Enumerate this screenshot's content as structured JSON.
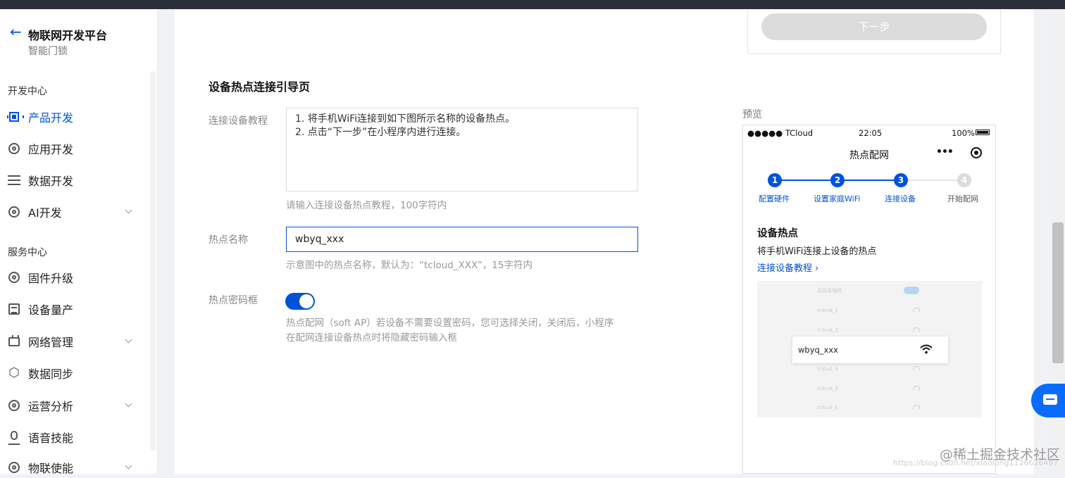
{
  "sidebar": {
    "back_icon": "arrow-left-icon",
    "app_title": "物联网开发平台",
    "app_subtitle": "智能门锁",
    "groups": [
      {
        "title": "开发中心"
      },
      {
        "title": "服务中心"
      }
    ],
    "items": [
      {
        "label": "产品开发",
        "icon": "chip-icon",
        "active": true
      },
      {
        "label": "应用开发",
        "icon": "app-ring-icon"
      },
      {
        "label": "数据开发",
        "icon": "data-flow-icon"
      },
      {
        "label": "AI开发",
        "icon": "ai-icon",
        "expandable": true
      },
      {
        "label": "固件升级",
        "icon": "firmware-icon"
      },
      {
        "label": "设备量产",
        "icon": "production-icon"
      },
      {
        "label": "网络管理",
        "icon": "network-icon",
        "expandable": true
      },
      {
        "label": "数据同步",
        "icon": "sync-icon"
      },
      {
        "label": "运营分析",
        "icon": "analytics-icon",
        "expandable": true
      },
      {
        "label": "语音技能",
        "icon": "voice-icon"
      },
      {
        "label": "物联使能",
        "icon": "iot-enable-icon",
        "expandable": true
      }
    ]
  },
  "top_card": {
    "next_button_label": "下一步"
  },
  "form": {
    "section_title": "设备热点连接引导页",
    "tutorial_label": "连接设备教程",
    "tutorial_value": "1. 将手机WiFi连接到如下图所示名称的设备热点。\n2. 点击“下一步”在小程序内进行连接。",
    "tutorial_hint": "请输入连接设备热点教程，100字符内",
    "hotspot_label": "热点名称",
    "hotspot_value": "wbyq_xxx",
    "hotspot_hint": "示意图中的热点名称，默认为：“tcloud_XXX”，15字符内",
    "password_label": "热点密码框",
    "password_toggle_on": true,
    "password_hint_1": "热点配网（soft AP）若设备不需要设置密码，您可选择关闭，关闭后，小程序",
    "password_hint_2": "在配网连接设备热点时将隐藏密码输入框"
  },
  "preview": {
    "label": "预览",
    "status_carrier": "●●●●● TCloud",
    "status_time": "22:05",
    "status_battery": "100%",
    "title": "热点配网",
    "menu_dots": "•••",
    "steps": [
      {
        "num": "1",
        "label": "配置硬件",
        "done": true
      },
      {
        "num": "2",
        "label": "设置家庭WiFi",
        "done": true
      },
      {
        "num": "3",
        "label": "连接设备",
        "done": true
      },
      {
        "num": "4",
        "label": "开始配网",
        "done": false
      }
    ],
    "heading": "设备热点",
    "desc": "将手机WiFi连接上设备的热点",
    "link": "连接设备教程 ›",
    "ghost_header": "无线局域网",
    "ghost_networks": [
      "tcloud_1",
      "tcloud_2",
      "tcloud_4",
      "tcloud_5",
      "tcloud_6"
    ],
    "selected_network": "wbyq_xxx"
  },
  "watermark": {
    "brand": "@稀土掘金技术社区",
    "url": "https://blog.csdn.net/xiaolong1126626497"
  },
  "colors": {
    "accent": "#0052d9",
    "chat_button": "#0a6cff"
  }
}
